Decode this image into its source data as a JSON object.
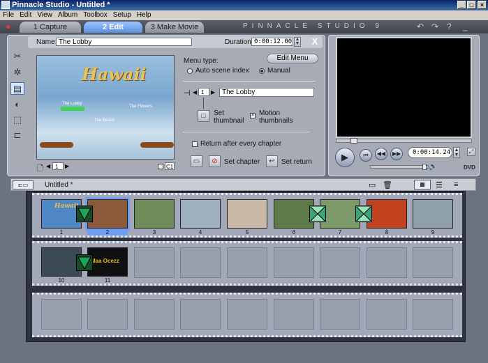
{
  "window": {
    "title": "Pinnacle Studio - Untitled *"
  },
  "menu": [
    "File",
    "Edit",
    "View",
    "Album",
    "Toolbox",
    "Setup",
    "Help"
  ],
  "modes": [
    {
      "label": "1 Capture"
    },
    {
      "label": "2 Edit"
    },
    {
      "label": "3 Make Movie"
    }
  ],
  "brand": "PINNACLE STUDIO 9",
  "editor": {
    "name_label": "Name:",
    "name_value": "The Lobby",
    "duration_label": "Duration:",
    "duration_value": "0:00:12.00",
    "preview_title": "Hawaii",
    "preview_links": [
      "The Lobby",
      "The Flowers",
      "The Beach"
    ],
    "page_number": "1",
    "c1_label": "C1",
    "menu_type_label": "Menu type:",
    "edit_menu_label": "Edit Menu",
    "auto_scene_label": "Auto scene index",
    "manual_label": "Manual",
    "chapter_number": "1",
    "chapter_name": "The Lobby",
    "set_thumbnail_label": "Set thumbnail",
    "motion_thumbnails_label": "Motion thumbnails",
    "return_after_label": "Return after every chapter",
    "set_chapter_label": "Set chapter",
    "set_return_label": "Set return"
  },
  "player": {
    "timecode": "0:00:14.24",
    "dvd_label": "DVD"
  },
  "storyboard": {
    "title": "Untitled *",
    "clips": [
      {
        "num": "1",
        "color": "#4f86c6"
      },
      {
        "num": "2",
        "color": "#8a5a3a"
      },
      {
        "num": "3",
        "color": "#6f8c5a"
      },
      {
        "num": "4",
        "color": "#9db0c0"
      },
      {
        "num": "5",
        "color": "#c9b9a6"
      },
      {
        "num": "6",
        "color": "#5e7a48"
      },
      {
        "num": "7",
        "color": "#7d9a6a"
      },
      {
        "num": "8",
        "color": "#c2411f"
      },
      {
        "num": "9",
        "color": "#8fa0a8"
      },
      {
        "num": "10",
        "color": "#3b4a55"
      },
      {
        "num": "11",
        "color": "#111111"
      }
    ],
    "clip11_text": "Maa Ocezz"
  }
}
